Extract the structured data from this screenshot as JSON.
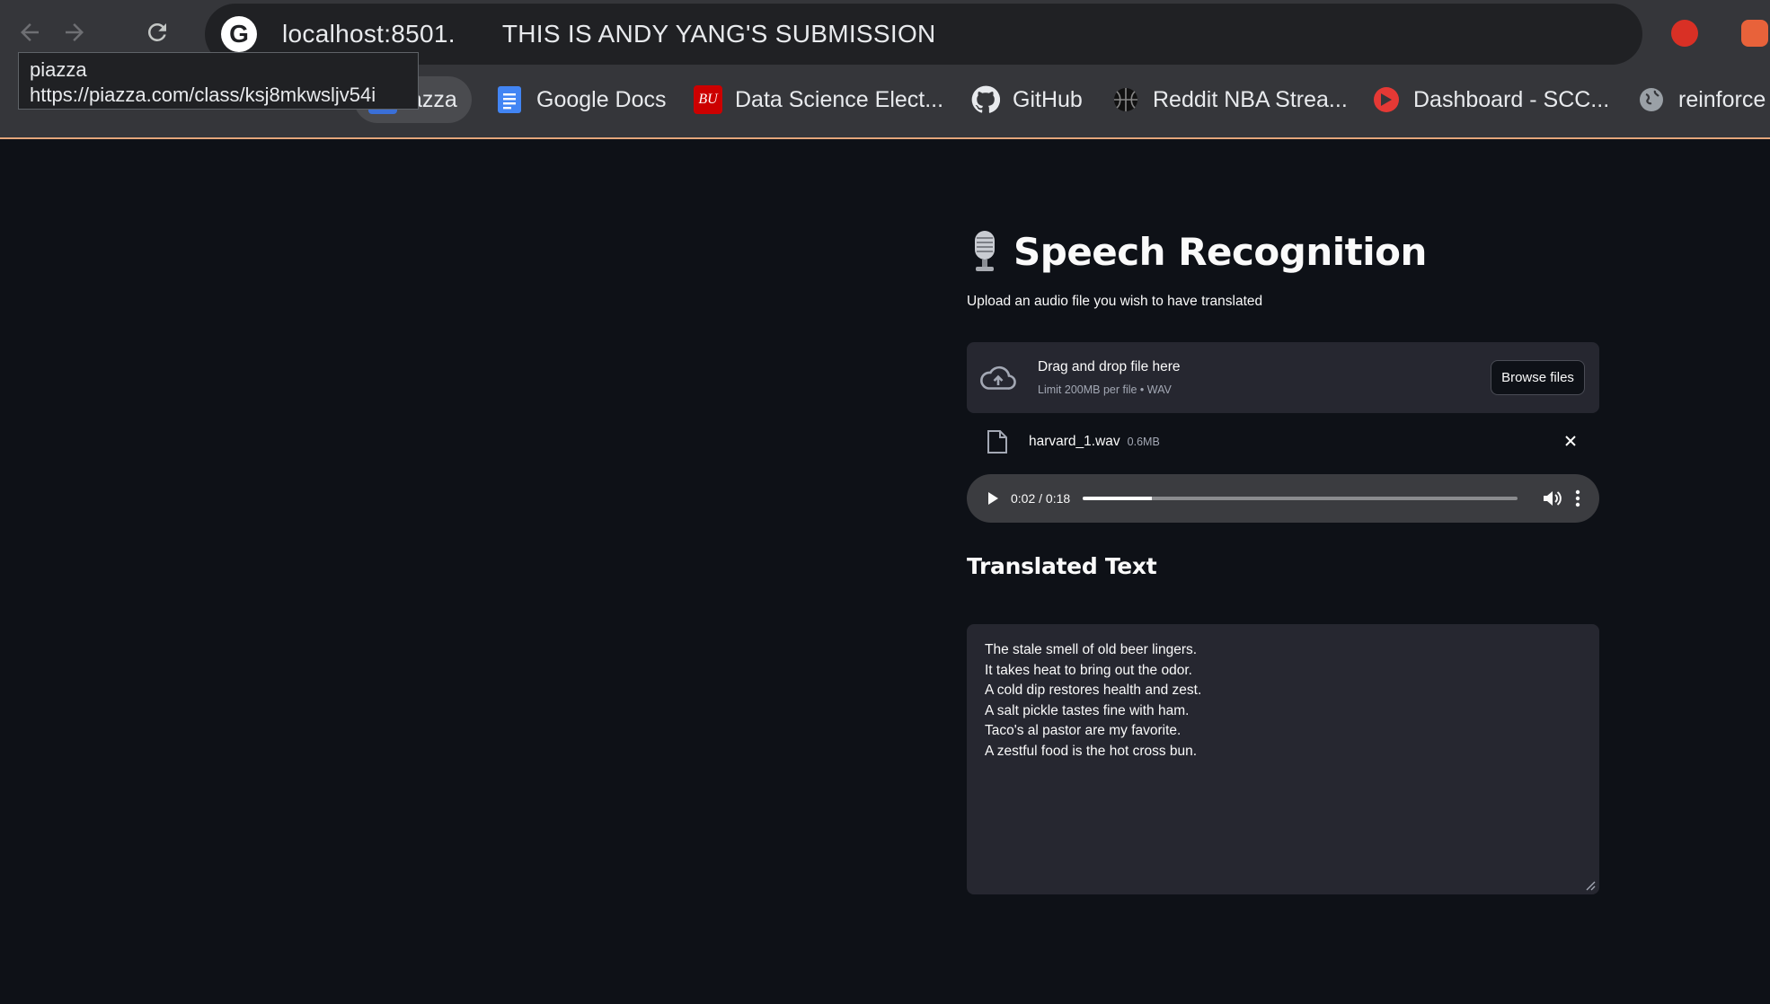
{
  "browser": {
    "omnibox": {
      "url": "localhost:8501.",
      "page_title": "THIS IS ANDY YANG'S SUBMISSION"
    },
    "tooltip": {
      "title": "piazza",
      "url": "https://piazza.com/class/ksj8mkwsljv54i"
    },
    "bookmarks": [
      {
        "label": "azza",
        "icon": "piazza-icon"
      },
      {
        "label": "Google Docs",
        "icon": "google-docs-icon"
      },
      {
        "label": "Data Science Elect...",
        "icon": "bu-icon",
        "icon_text": "BU"
      },
      {
        "label": "GitHub",
        "icon": "github-icon"
      },
      {
        "label": "Reddit NBA Strea...",
        "icon": "basketball-icon"
      },
      {
        "label": "Dashboard - SCC...",
        "icon": "dashboard-icon"
      },
      {
        "label": "reinforce",
        "icon": "globe-icon"
      }
    ]
  },
  "app": {
    "title": "Speech Recognition",
    "title_icon": "microphone-icon",
    "subtitle": "Upload an audio file you wish to have translated",
    "uploader": {
      "drag_text": "Drag and drop file here",
      "limit_text": "Limit 200MB per file • WAV",
      "browse_label": "Browse files"
    },
    "file": {
      "name": "harvard_1.wav",
      "size": "0.6MB"
    },
    "audio": {
      "time": "0:02 / 0:18",
      "progress": 0.16
    },
    "translated": {
      "heading": "Translated Text",
      "lines": [
        "The stale smell of old beer lingers.",
        "It takes heat to bring out the odor.",
        "A cold dip restores health and zest.",
        "A salt pickle tastes fine with ham.",
        "Taco's al pastor are my favorite.",
        "A zestful food is the hot cross bun."
      ]
    }
  },
  "colors": {
    "app_bg": "#0e1117",
    "widget_bg": "#262730",
    "chrome_bg": "#35363a",
    "omnibox_bg": "#202124",
    "accent_line": "#e3a57a"
  }
}
